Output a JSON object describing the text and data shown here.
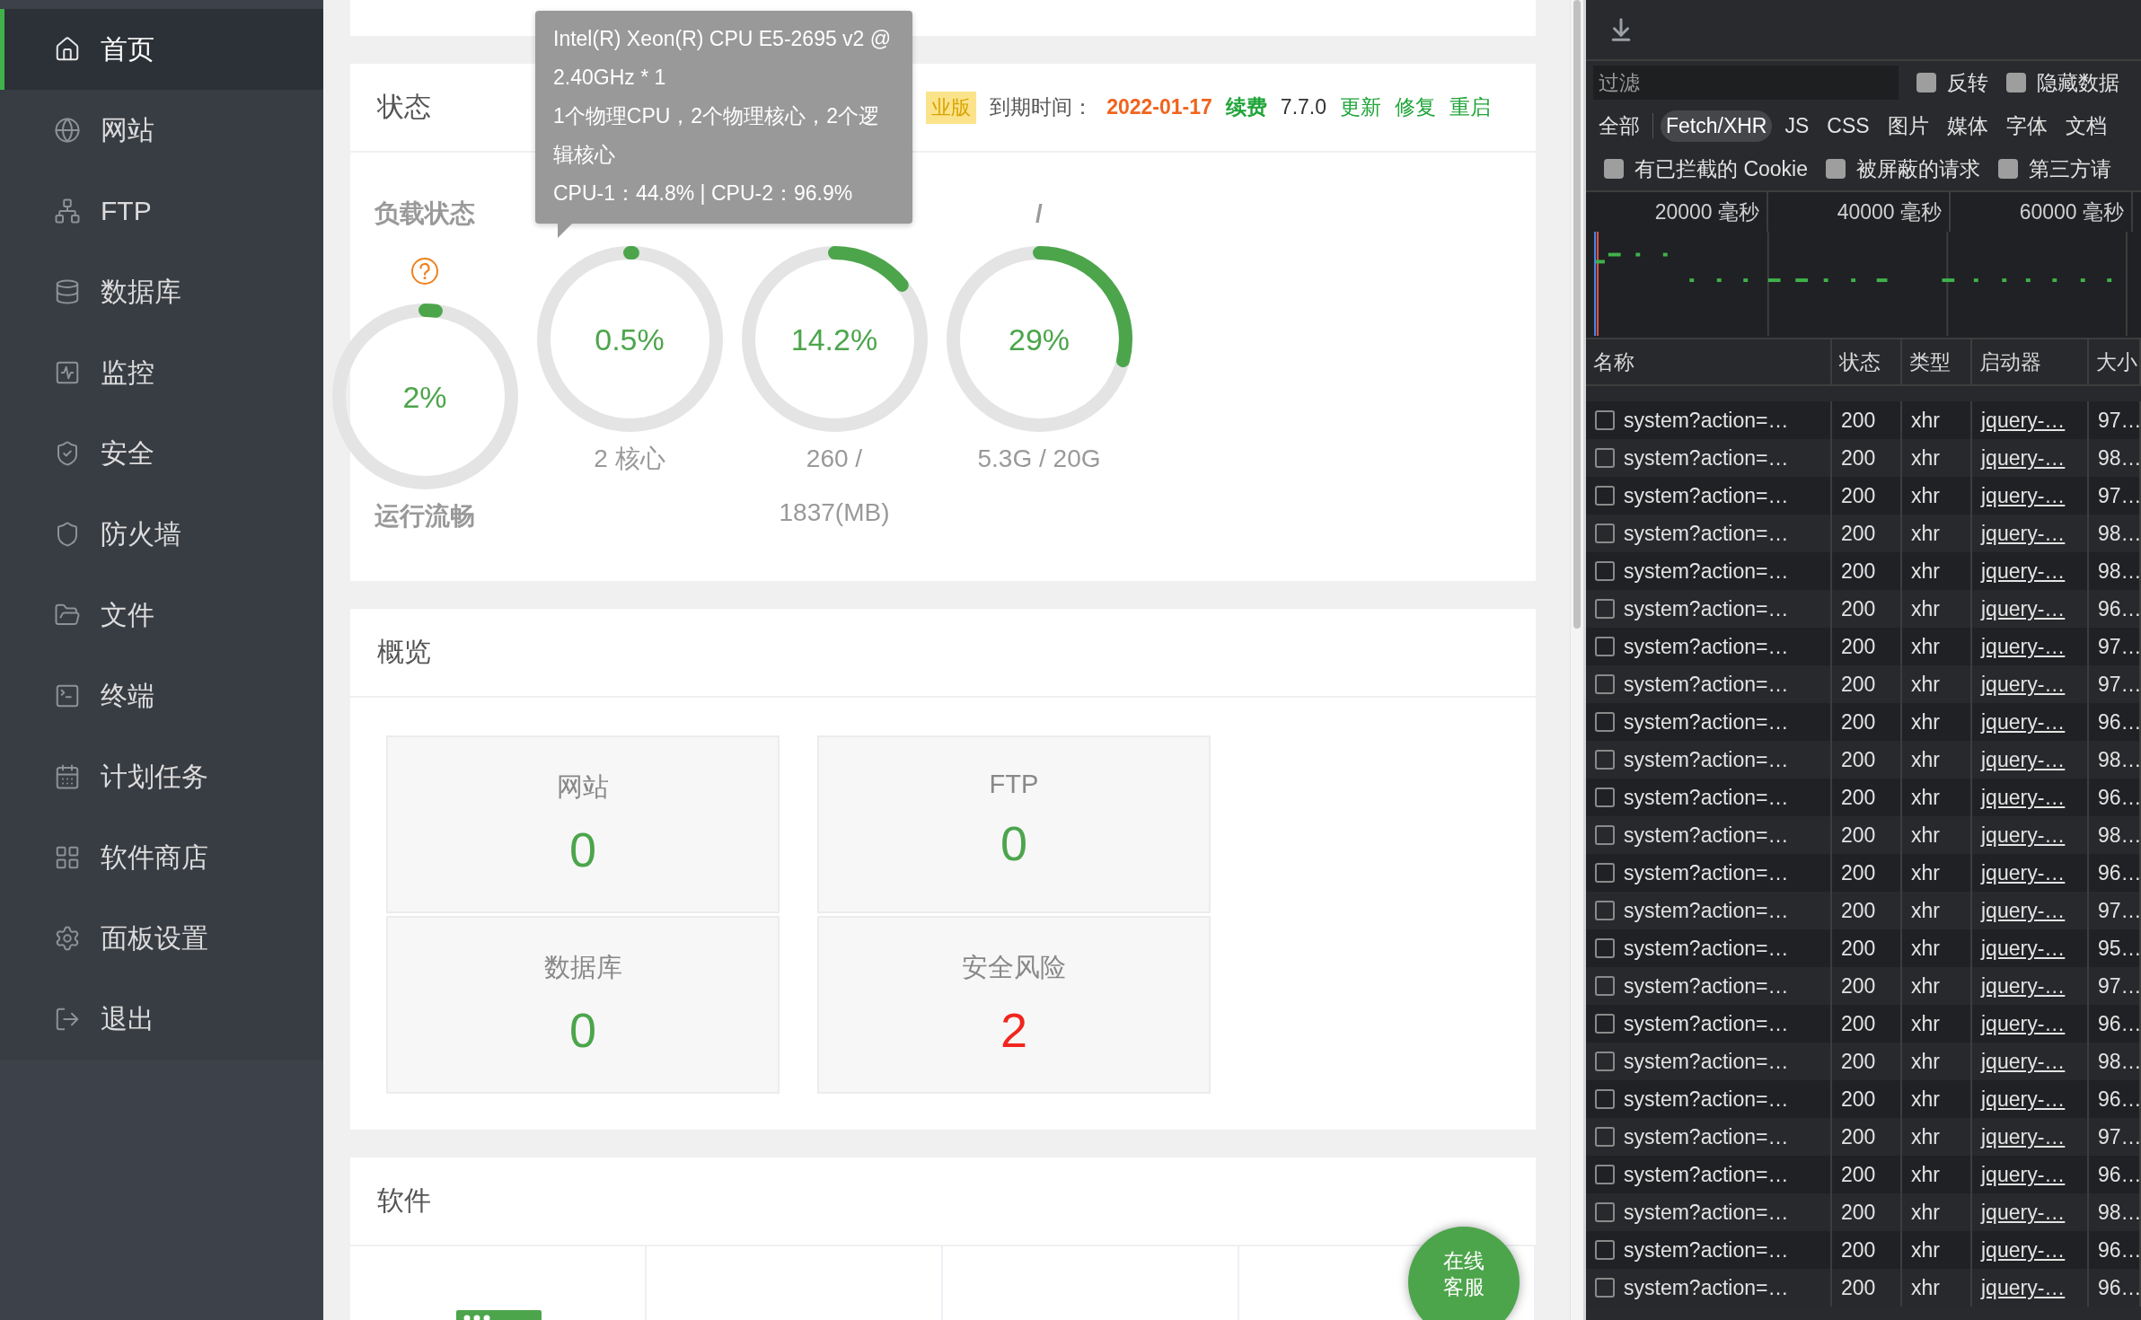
{
  "sidebar": {
    "items": [
      {
        "label": "首页",
        "selected": true
      },
      {
        "label": "网站",
        "selected": false
      },
      {
        "label": "FTP",
        "selected": false
      },
      {
        "label": "数据库",
        "selected": false
      },
      {
        "label": "监控",
        "selected": false
      },
      {
        "label": "安全",
        "selected": false
      },
      {
        "label": "防火墙",
        "selected": false
      },
      {
        "label": "文件",
        "selected": false
      },
      {
        "label": "终端",
        "selected": false
      },
      {
        "label": "计划任务",
        "selected": false
      },
      {
        "label": "软件商店",
        "selected": false
      },
      {
        "label": "面板设置",
        "selected": false
      },
      {
        "label": "退出",
        "selected": false
      }
    ]
  },
  "status": {
    "title": "状态",
    "edition_badge": "业版",
    "expiry_label": "到期时间：",
    "expiry_date": "2022-01-17",
    "renew_link": "续费",
    "version": "7.7.0",
    "actions": [
      "更新",
      "修复",
      "重启"
    ],
    "gauges": [
      {
        "kind": "load",
        "title": "负载状态",
        "reading": "2%",
        "level": 0.02,
        "caption": "运行流畅"
      },
      {
        "kind": "cpu",
        "reading": "0.5%",
        "level": 0.005,
        "caption": "2 核心"
      },
      {
        "kind": "memory",
        "reading": "14.2%",
        "level": 0.142,
        "caption": "260 / 1837(MB)"
      },
      {
        "kind": "disk",
        "title": "/",
        "reading": "29%",
        "level": 0.29,
        "caption": "5.3G / 20G"
      }
    ],
    "tooltip": [
      "Intel(R) Xeon(R) CPU E5-2695 v2 @ 2.40GHz * 1",
      "1个物理CPU，2个物理核心，2个逻辑核心",
      "CPU-1：44.8% | CPU-2：96.9%"
    ]
  },
  "overview": {
    "title": "概览",
    "cards": [
      {
        "label": "网站",
        "value": "0",
        "alert": false
      },
      {
        "label": "FTP",
        "value": "0",
        "alert": false
      },
      {
        "label": "数据库",
        "value": "0",
        "alert": false
      },
      {
        "label": "安全风险",
        "value": "2",
        "alert": true
      }
    ]
  },
  "software": {
    "title": "软件"
  },
  "chat_button": "在线客服",
  "devtools": {
    "filter": {
      "placeholder": "过滤"
    },
    "filter_options": [
      {
        "label": "反转",
        "checked": false
      },
      {
        "label": "隐藏数据",
        "checked": false
      }
    ],
    "types": [
      {
        "label": "全部",
        "selected": false
      },
      {
        "label": "Fetch/XHR",
        "selected": true
      },
      {
        "label": "JS",
        "selected": false
      },
      {
        "label": "CSS",
        "selected": false
      },
      {
        "label": "图片",
        "selected": false
      },
      {
        "label": "媒体",
        "selected": false
      },
      {
        "label": "字体",
        "selected": false
      },
      {
        "label": "文档",
        "selected": false
      }
    ],
    "request_options": [
      {
        "label": "有已拦截的 Cookie",
        "checked": false
      },
      {
        "label": "被屏蔽的请求",
        "checked": false
      },
      {
        "label": "第三方请",
        "checked": false
      }
    ],
    "timeline_ticks": [
      "20000 毫秒",
      "40000 毫秒",
      "60000 毫秒"
    ],
    "table": {
      "columns": [
        "名称",
        "状态",
        "类型",
        "启动器",
        "大小"
      ],
      "rows": [
        {
          "name": "system?action=…",
          "status": "200",
          "type": "xhr",
          "initiator": "jquery-…",
          "size": "97…",
          "checked": false
        },
        {
          "name": "system?action=…",
          "status": "200",
          "type": "xhr",
          "initiator": "jquery-…",
          "size": "98…",
          "checked": false
        },
        {
          "name": "system?action=…",
          "status": "200",
          "type": "xhr",
          "initiator": "jquery-…",
          "size": "97…",
          "checked": false
        },
        {
          "name": "system?action=…",
          "status": "200",
          "type": "xhr",
          "initiator": "jquery-…",
          "size": "98…",
          "checked": false
        },
        {
          "name": "system?action=…",
          "status": "200",
          "type": "xhr",
          "initiator": "jquery-…",
          "size": "98…",
          "checked": false
        },
        {
          "name": "system?action=…",
          "status": "200",
          "type": "xhr",
          "initiator": "jquery-…",
          "size": "96…",
          "checked": false
        },
        {
          "name": "system?action=…",
          "status": "200",
          "type": "xhr",
          "initiator": "jquery-…",
          "size": "97…",
          "checked": false
        },
        {
          "name": "system?action=…",
          "status": "200",
          "type": "xhr",
          "initiator": "jquery-…",
          "size": "97…",
          "checked": false
        },
        {
          "name": "system?action=…",
          "status": "200",
          "type": "xhr",
          "initiator": "jquery-…",
          "size": "96…",
          "checked": false
        },
        {
          "name": "system?action=…",
          "status": "200",
          "type": "xhr",
          "initiator": "jquery-…",
          "size": "98…",
          "checked": false
        },
        {
          "name": "system?action=…",
          "status": "200",
          "type": "xhr",
          "initiator": "jquery-…",
          "size": "96…",
          "checked": false
        },
        {
          "name": "system?action=…",
          "status": "200",
          "type": "xhr",
          "initiator": "jquery-…",
          "size": "98…",
          "checked": false
        },
        {
          "name": "system?action=…",
          "status": "200",
          "type": "xhr",
          "initiator": "jquery-…",
          "size": "96…",
          "checked": false
        },
        {
          "name": "system?action=…",
          "status": "200",
          "type": "xhr",
          "initiator": "jquery-…",
          "size": "97…",
          "checked": false
        },
        {
          "name": "system?action=…",
          "status": "200",
          "type": "xhr",
          "initiator": "jquery-…",
          "size": "95…",
          "checked": false
        },
        {
          "name": "system?action=…",
          "status": "200",
          "type": "xhr",
          "initiator": "jquery-…",
          "size": "97…",
          "checked": false
        },
        {
          "name": "system?action=…",
          "status": "200",
          "type": "xhr",
          "initiator": "jquery-…",
          "size": "96…",
          "checked": false
        },
        {
          "name": "system?action=…",
          "status": "200",
          "type": "xhr",
          "initiator": "jquery-…",
          "size": "98…",
          "checked": false
        },
        {
          "name": "system?action=…",
          "status": "200",
          "type": "xhr",
          "initiator": "jquery-…",
          "size": "96…",
          "checked": false
        },
        {
          "name": "system?action=…",
          "status": "200",
          "type": "xhr",
          "initiator": "jquery-…",
          "size": "97…",
          "checked": false
        },
        {
          "name": "system?action=…",
          "status": "200",
          "type": "xhr",
          "initiator": "jquery-…",
          "size": "96…",
          "checked": false
        },
        {
          "name": "system?action=…",
          "status": "200",
          "type": "xhr",
          "initiator": "jquery-…",
          "size": "98…",
          "checked": false
        },
        {
          "name": "system?action=…",
          "status": "200",
          "type": "xhr",
          "initiator": "jquery-…",
          "size": "96…",
          "checked": false
        },
        {
          "name": "system?action=…",
          "status": "200",
          "type": "xhr",
          "initiator": "jquery-…",
          "size": "96…",
          "checked": false
        }
      ]
    }
  }
}
